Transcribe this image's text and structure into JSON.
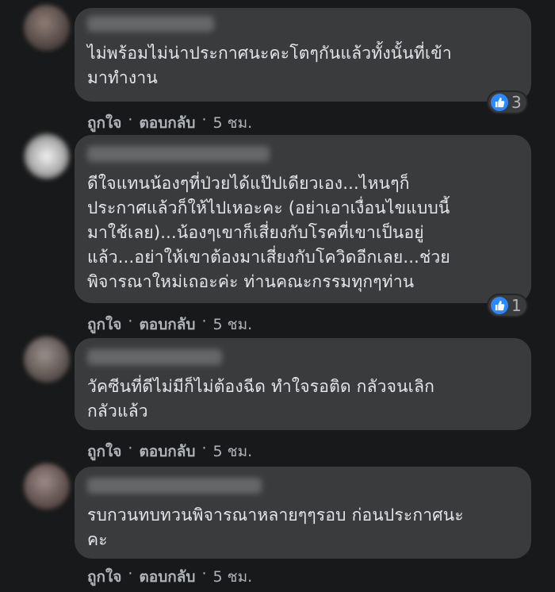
{
  "comments": [
    {
      "text": "ไม่พร้อมไม่น่าประกาศนะคะโตๆกันแล้วทั้งนั้นที่เข้า\nมาทำงาน",
      "reactions": {
        "icon": "like-icon",
        "count": "3"
      },
      "actions": {
        "like": "ถูกใจ",
        "reply": "ตอบกลับ",
        "time": "5 ชม."
      }
    },
    {
      "text": "ดีใจแทนน้องๆที่ป่วยได้แป๊ปเดียวเอง...ไหนๆก็\nประกาศแล้วก็ให้ไปเหอะคะ (อย่าเอาเงื่อนไขแบบนี้\nมาใช้เลย)...น้องๆเขาก็เสี่ยงกับโรคที่เขาเป็นอยู่\nแล้ว...อย่าให้เขาต้องมาเสี่ยงกับโควิดอีกเลย...ช่วย\nพิจารณาใหม่เถอะค่ะ ท่านคณะกรรมทุกๆท่าน",
      "reactions": {
        "icon": "like-icon",
        "count": "1"
      },
      "actions": {
        "like": "ถูกใจ",
        "reply": "ตอบกลับ",
        "time": "5 ชม."
      }
    },
    {
      "text": "วัคซีนที่ดีไม่มีก็ไม่ต้องฉีด ทำใจรอติด กลัวจนเลิก\nกลัวแล้ว",
      "actions": {
        "like": "ถูกใจ",
        "reply": "ตอบกลับ",
        "time": "5 ชม."
      }
    },
    {
      "text": "รบกวนทบทวนพิจารณาหลายๆๆรอบ ก่อนประกาศนะ\nคะ",
      "actions": {
        "like": "ถูกใจ",
        "reply": "ตอบกลับ",
        "time": "5 ชม."
      }
    }
  ],
  "colors": {
    "page_bg": "#18191a",
    "bubble_bg": "#3a3b3c",
    "text": "#e4e6eb",
    "meta_text": "#b0b3b8",
    "like_blue": "#2d88ff"
  }
}
